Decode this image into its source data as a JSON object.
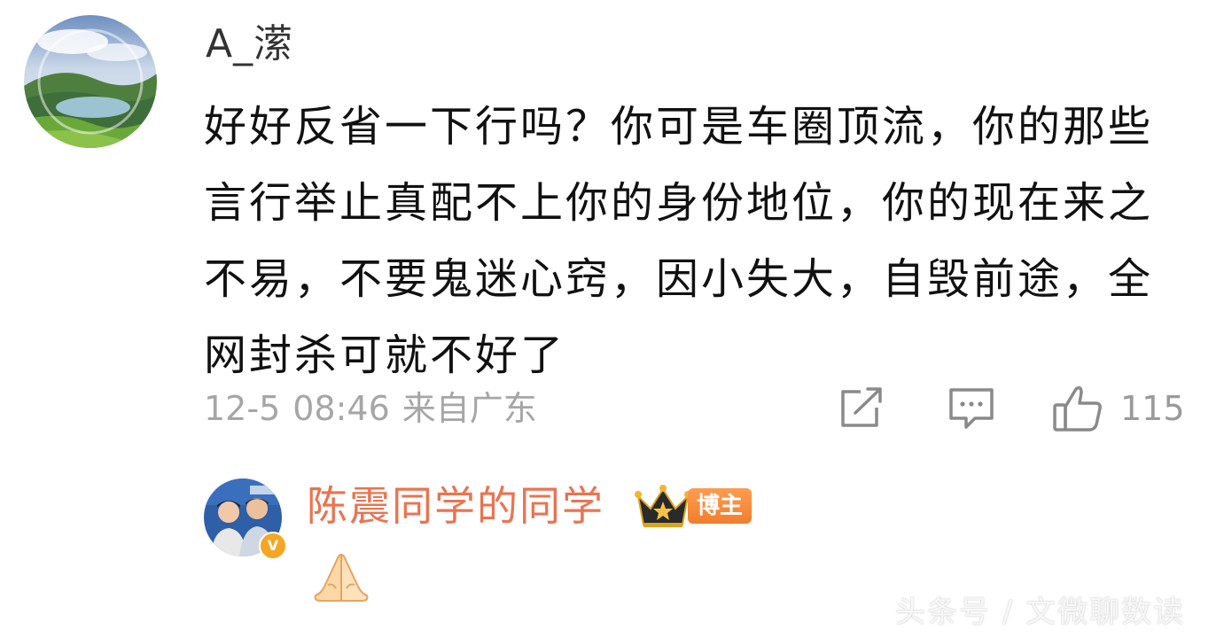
{
  "comment": {
    "avatar_icon": "landscape-avatar",
    "username": "A_潆",
    "text": "好好反省一下行吗？你可是车圈顶流，你的那些言行举止真配不上你的身份地位，你的现在来之不易，不要鬼迷心窍，因小失大，自毁前途，全网封杀可就不好了",
    "date": "12-5",
    "time": "08:46",
    "location": "来自广东",
    "actions": {
      "share_icon": "share-icon",
      "comment_icon": "comment-icon",
      "like_icon": "thumbs-up-icon",
      "like_count": "115"
    }
  },
  "reply": {
    "avatar_icon": "two-men-avatar",
    "verified_icon": "verified-v-icon",
    "verified_mark": "V",
    "username": "陈震同学的同学",
    "crown_icon": "crown-icon",
    "role_badge": "博主",
    "emoji_icon": "folded-hands-emoji"
  },
  "watermark": "头条号 / 文微聊数读",
  "colors": {
    "username_reply": "#eb7350",
    "meta_gray": "#a6a6a6",
    "badge_orange": "#f07f2d",
    "verified_gold": "#f6a623"
  }
}
